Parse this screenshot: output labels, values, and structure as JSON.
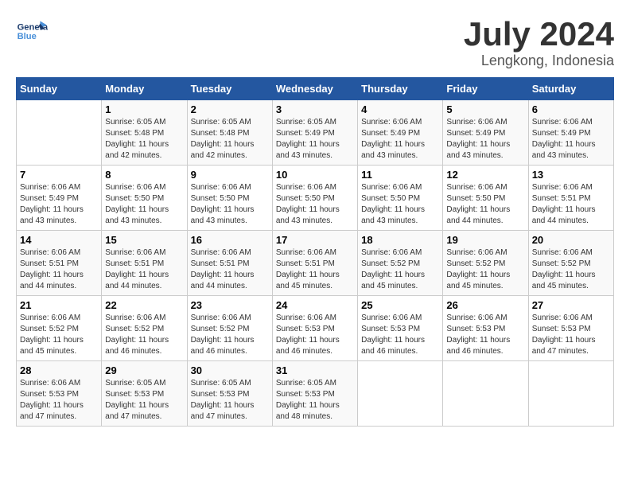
{
  "header": {
    "logo_general": "General",
    "logo_blue": "Blue",
    "title": "July 2024",
    "subtitle": "Lengkong, Indonesia"
  },
  "columns": [
    "Sunday",
    "Monday",
    "Tuesday",
    "Wednesday",
    "Thursday",
    "Friday",
    "Saturday"
  ],
  "weeks": [
    [
      {
        "day": "",
        "sunrise": "",
        "sunset": "",
        "daylight": ""
      },
      {
        "day": "1",
        "sunrise": "Sunrise: 6:05 AM",
        "sunset": "Sunset: 5:48 PM",
        "daylight": "Daylight: 11 hours and 42 minutes."
      },
      {
        "day": "2",
        "sunrise": "Sunrise: 6:05 AM",
        "sunset": "Sunset: 5:48 PM",
        "daylight": "Daylight: 11 hours and 42 minutes."
      },
      {
        "day": "3",
        "sunrise": "Sunrise: 6:05 AM",
        "sunset": "Sunset: 5:49 PM",
        "daylight": "Daylight: 11 hours and 43 minutes."
      },
      {
        "day": "4",
        "sunrise": "Sunrise: 6:06 AM",
        "sunset": "Sunset: 5:49 PM",
        "daylight": "Daylight: 11 hours and 43 minutes."
      },
      {
        "day": "5",
        "sunrise": "Sunrise: 6:06 AM",
        "sunset": "Sunset: 5:49 PM",
        "daylight": "Daylight: 11 hours and 43 minutes."
      },
      {
        "day": "6",
        "sunrise": "Sunrise: 6:06 AM",
        "sunset": "Sunset: 5:49 PM",
        "daylight": "Daylight: 11 hours and 43 minutes."
      }
    ],
    [
      {
        "day": "7",
        "sunrise": "Sunrise: 6:06 AM",
        "sunset": "Sunset: 5:49 PM",
        "daylight": "Daylight: 11 hours and 43 minutes."
      },
      {
        "day": "8",
        "sunrise": "Sunrise: 6:06 AM",
        "sunset": "Sunset: 5:50 PM",
        "daylight": "Daylight: 11 hours and 43 minutes."
      },
      {
        "day": "9",
        "sunrise": "Sunrise: 6:06 AM",
        "sunset": "Sunset: 5:50 PM",
        "daylight": "Daylight: 11 hours and 43 minutes."
      },
      {
        "day": "10",
        "sunrise": "Sunrise: 6:06 AM",
        "sunset": "Sunset: 5:50 PM",
        "daylight": "Daylight: 11 hours and 43 minutes."
      },
      {
        "day": "11",
        "sunrise": "Sunrise: 6:06 AM",
        "sunset": "Sunset: 5:50 PM",
        "daylight": "Daylight: 11 hours and 43 minutes."
      },
      {
        "day": "12",
        "sunrise": "Sunrise: 6:06 AM",
        "sunset": "Sunset: 5:50 PM",
        "daylight": "Daylight: 11 hours and 44 minutes."
      },
      {
        "day": "13",
        "sunrise": "Sunrise: 6:06 AM",
        "sunset": "Sunset: 5:51 PM",
        "daylight": "Daylight: 11 hours and 44 minutes."
      }
    ],
    [
      {
        "day": "14",
        "sunrise": "Sunrise: 6:06 AM",
        "sunset": "Sunset: 5:51 PM",
        "daylight": "Daylight: 11 hours and 44 minutes."
      },
      {
        "day": "15",
        "sunrise": "Sunrise: 6:06 AM",
        "sunset": "Sunset: 5:51 PM",
        "daylight": "Daylight: 11 hours and 44 minutes."
      },
      {
        "day": "16",
        "sunrise": "Sunrise: 6:06 AM",
        "sunset": "Sunset: 5:51 PM",
        "daylight": "Daylight: 11 hours and 44 minutes."
      },
      {
        "day": "17",
        "sunrise": "Sunrise: 6:06 AM",
        "sunset": "Sunset: 5:51 PM",
        "daylight": "Daylight: 11 hours and 45 minutes."
      },
      {
        "day": "18",
        "sunrise": "Sunrise: 6:06 AM",
        "sunset": "Sunset: 5:52 PM",
        "daylight": "Daylight: 11 hours and 45 minutes."
      },
      {
        "day": "19",
        "sunrise": "Sunrise: 6:06 AM",
        "sunset": "Sunset: 5:52 PM",
        "daylight": "Daylight: 11 hours and 45 minutes."
      },
      {
        "day": "20",
        "sunrise": "Sunrise: 6:06 AM",
        "sunset": "Sunset: 5:52 PM",
        "daylight": "Daylight: 11 hours and 45 minutes."
      }
    ],
    [
      {
        "day": "21",
        "sunrise": "Sunrise: 6:06 AM",
        "sunset": "Sunset: 5:52 PM",
        "daylight": "Daylight: 11 hours and 45 minutes."
      },
      {
        "day": "22",
        "sunrise": "Sunrise: 6:06 AM",
        "sunset": "Sunset: 5:52 PM",
        "daylight": "Daylight: 11 hours and 46 minutes."
      },
      {
        "day": "23",
        "sunrise": "Sunrise: 6:06 AM",
        "sunset": "Sunset: 5:52 PM",
        "daylight": "Daylight: 11 hours and 46 minutes."
      },
      {
        "day": "24",
        "sunrise": "Sunrise: 6:06 AM",
        "sunset": "Sunset: 5:53 PM",
        "daylight": "Daylight: 11 hours and 46 minutes."
      },
      {
        "day": "25",
        "sunrise": "Sunrise: 6:06 AM",
        "sunset": "Sunset: 5:53 PM",
        "daylight": "Daylight: 11 hours and 46 minutes."
      },
      {
        "day": "26",
        "sunrise": "Sunrise: 6:06 AM",
        "sunset": "Sunset: 5:53 PM",
        "daylight": "Daylight: 11 hours and 46 minutes."
      },
      {
        "day": "27",
        "sunrise": "Sunrise: 6:06 AM",
        "sunset": "Sunset: 5:53 PM",
        "daylight": "Daylight: 11 hours and 47 minutes."
      }
    ],
    [
      {
        "day": "28",
        "sunrise": "Sunrise: 6:06 AM",
        "sunset": "Sunset: 5:53 PM",
        "daylight": "Daylight: 11 hours and 47 minutes."
      },
      {
        "day": "29",
        "sunrise": "Sunrise: 6:05 AM",
        "sunset": "Sunset: 5:53 PM",
        "daylight": "Daylight: 11 hours and 47 minutes."
      },
      {
        "day": "30",
        "sunrise": "Sunrise: 6:05 AM",
        "sunset": "Sunset: 5:53 PM",
        "daylight": "Daylight: 11 hours and 47 minutes."
      },
      {
        "day": "31",
        "sunrise": "Sunrise: 6:05 AM",
        "sunset": "Sunset: 5:53 PM",
        "daylight": "Daylight: 11 hours and 48 minutes."
      },
      {
        "day": "",
        "sunrise": "",
        "sunset": "",
        "daylight": ""
      },
      {
        "day": "",
        "sunrise": "",
        "sunset": "",
        "daylight": ""
      },
      {
        "day": "",
        "sunrise": "",
        "sunset": "",
        "daylight": ""
      }
    ]
  ]
}
